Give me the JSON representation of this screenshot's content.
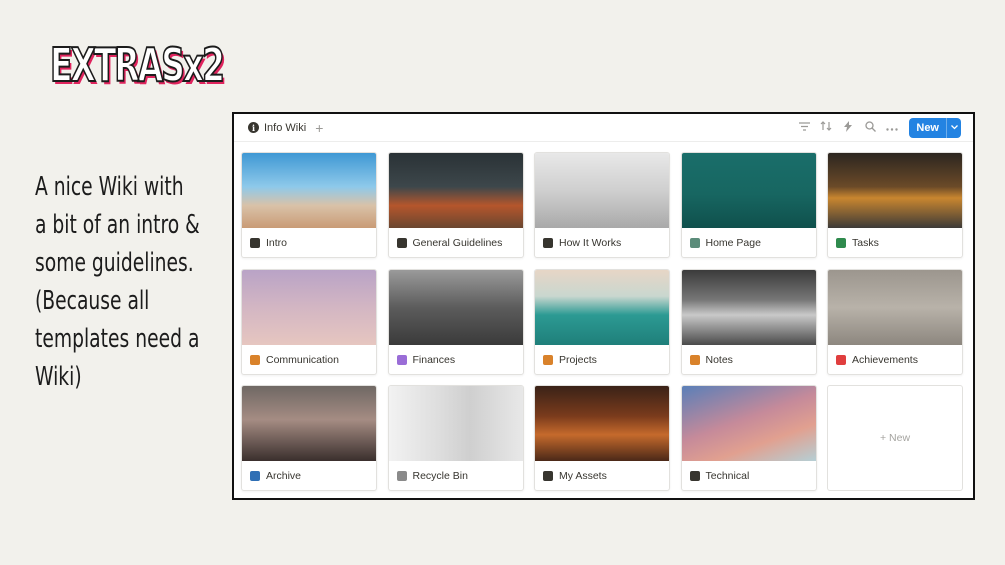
{
  "slide": {
    "title": "EXTRASx2",
    "lines": [
      "A nice Wiki with",
      "a bit of an intro &",
      "some guidelines.",
      "(Because all",
      "templates need a",
      "Wiki)"
    ]
  },
  "toolbar": {
    "tab_label": "Info Wiki",
    "new_label": "New",
    "icons": [
      "filter-icon",
      "sort-icon",
      "lightning-icon",
      "search-icon",
      "more-icon",
      "chevron-down-icon"
    ]
  },
  "cards": [
    {
      "label": "Intro",
      "icon": "plane-icon",
      "icon_color": "#37352f",
      "bg": "linear-gradient(180deg,#3f98d4 0%,#8ec9ea 45%,#d9c2a8 70%,#c99b76 100%)"
    },
    {
      "label": "General Guidelines",
      "icon": "signpost-icon",
      "icon_color": "#37352f",
      "bg": "linear-gradient(180deg,#2a3236 0%,#3d474b 45%,#b5562c 70%,#6a4630 100%)"
    },
    {
      "label": "How It Works",
      "icon": "microscope-icon",
      "icon_color": "#37352f",
      "bg": "linear-gradient(180deg,#e8e8e8 0%,#cfcfcf 50%,#a9a9a9 100%)"
    },
    {
      "label": "Home Page",
      "icon": "picture-icon",
      "icon_color": "#5b8c7a",
      "bg": "linear-gradient(180deg,#1a6e6a 0%,#176661 55%,#0f504c 100%)"
    },
    {
      "label": "Tasks",
      "icon": "gear-icon",
      "icon_color": "#2f8a4d",
      "bg": "linear-gradient(180deg,#2c2620 0%,#6b4a28 45%,#c9862f 60%,#3d3a38 100%)"
    },
    {
      "label": "Communication",
      "icon": "person-icon",
      "icon_color": "#d9822b",
      "bg": "linear-gradient(180deg,#b9a3c6 0%,#d3b6c3 50%,#e6c6c0 100%)"
    },
    {
      "label": "Finances",
      "icon": "card-icon",
      "icon_color": "#9a6dd7",
      "bg": "linear-gradient(180deg,#9a9a9a 0%,#5c5c5c 50%,#3a3a3a 100%)"
    },
    {
      "label": "Projects",
      "icon": "sailboat-icon",
      "icon_color": "#d9822b",
      "bg": "linear-gradient(180deg,#e7d6c6 0%,#c9d7cf 35%,#2c9a93 60%,#1f7f7a 100%)"
    },
    {
      "label": "Notes",
      "icon": "edit-icon",
      "icon_color": "#d9822b",
      "bg": "linear-gradient(180deg,#3b3b3b 0%,#777 40%,#c9c9c9 60%,#4a4a4a 100%)"
    },
    {
      "label": "Achievements",
      "icon": "camera-icon",
      "icon_color": "#e03e3e",
      "bg": "linear-gradient(180deg,#9c968e 0%,#b8b2a9 50%,#8d877f 100%)"
    },
    {
      "label": "Archive",
      "icon": "book-icon",
      "icon_color": "#2f6fb5",
      "bg": "linear-gradient(180deg,#6f6864 0%,#a58c83 45%,#3a2f2d 100%)"
    },
    {
      "label": "Recycle Bin",
      "icon": "trash-icon",
      "icon_color": "#8a8a8a",
      "bg": "linear-gradient(90deg,#f2f2f2 0%,#dcdcdc 40%,#cfcfcf 60%,#e8e8e8 100%)"
    },
    {
      "label": "My Assets",
      "icon": "invader-icon",
      "icon_color": "#37352f",
      "bg": "linear-gradient(180deg,#3a2217 0%,#7a3b1c 40%,#c56a2c 65%,#4b2818 100%)"
    },
    {
      "label": "Technical",
      "icon": "wrench-icon",
      "icon_color": "#37352f",
      "bg": "linear-gradient(160deg,#5a7fb8 0%,#c58a9a 45%,#e1a090 70%,#b5cfd5 100%)"
    }
  ],
  "new_card_label": "+ New"
}
